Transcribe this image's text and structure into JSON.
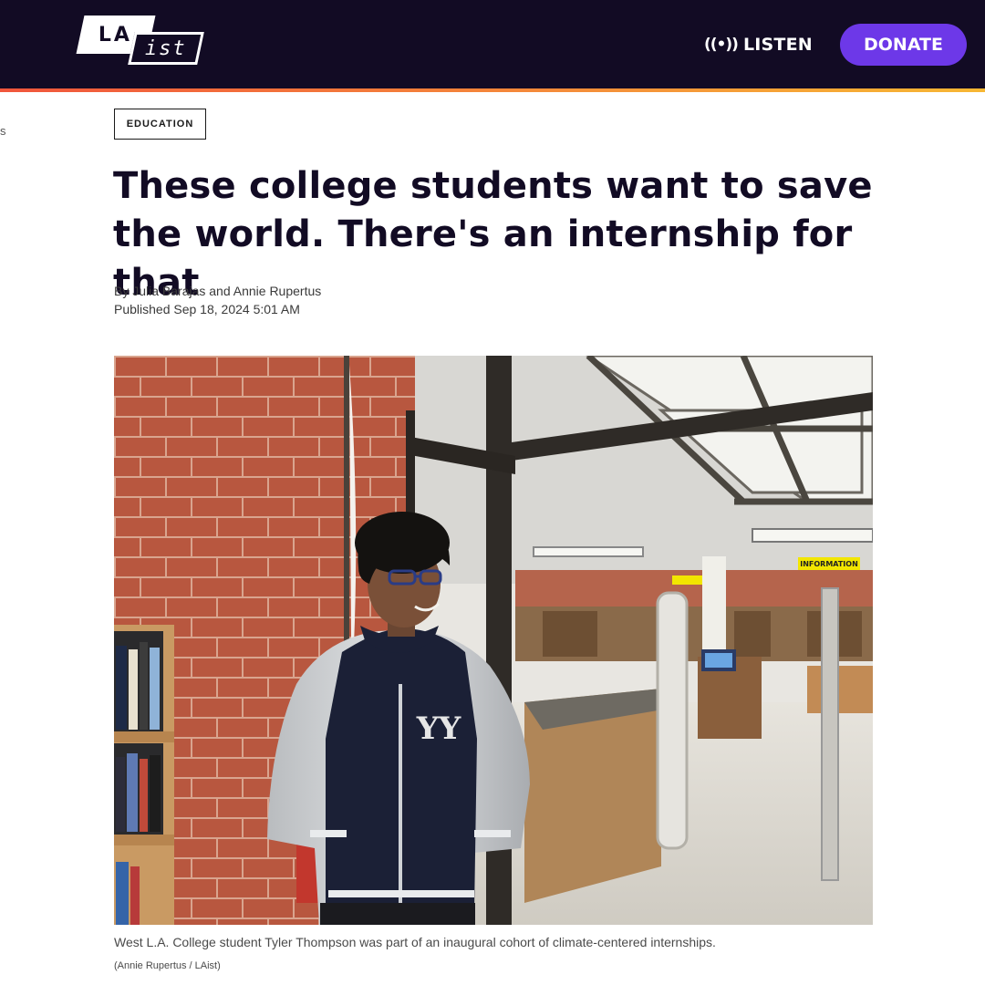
{
  "header": {
    "logo_left": "LA",
    "logo_right": "ist",
    "listen_icon": "((•))",
    "listen_label": "LISTEN",
    "donate_label": "DONATE",
    "colors": {
      "background": "#120b24",
      "donate": "#6d38e8",
      "accent_start": "#f0563c",
      "accent_end": "#f7b733"
    }
  },
  "edge_text": "s",
  "article": {
    "category": "EDUCATION",
    "title": "These college students want to save the world. There's an internship for that",
    "byline": "By Julia Barajas and Annie Rupertus",
    "published": "Published Sep 18, 2024 5:01 AM",
    "image": {
      "sign_text": "INFORMATION",
      "caption": "West L.A. College student Tyler Thompson was part of an inaugural cohort of climate-centered internships.",
      "credit": "(Annie Rupertus / LAist)"
    }
  },
  "icons": {
    "listen": "broadcast-icon"
  }
}
